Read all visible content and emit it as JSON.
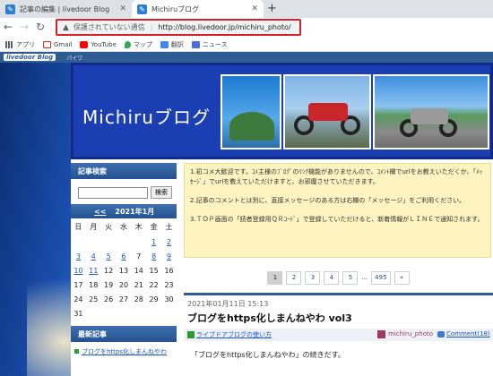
{
  "browser": {
    "tabs": [
      {
        "title": "記事の編集 | livedoor Blog",
        "favicon": "livedoor-favicon",
        "active": false
      },
      {
        "title": "Michiruブログ",
        "favicon": "livedoor-favicon",
        "active": true
      }
    ],
    "new_tab_label": "+",
    "address_bar": {
      "security_text": "保護されていない通信",
      "separator": "|",
      "url": "http://blog.livedoor.jp/michiru_photo/"
    },
    "bookmarks": [
      {
        "label": "アプリ",
        "icon": "apps-grid-icon",
        "color": "#5f6368"
      },
      {
        "label": "Gmail",
        "icon": "gmail-icon",
        "color": "#d93025"
      },
      {
        "label": "YouTube",
        "icon": "youtube-icon",
        "color": "#ff0000"
      },
      {
        "label": "マップ",
        "icon": "maps-pin-icon",
        "color": "#34a853"
      },
      {
        "label": "翻訳",
        "icon": "translate-icon",
        "color": "#4285f4"
      },
      {
        "label": "ニュース",
        "icon": "news-icon",
        "color": "#4a6fd8"
      }
    ]
  },
  "livedoor_bar": {
    "logo": "livedoor",
    "logo_suffix": "Blog",
    "link": "パイワ"
  },
  "header": {
    "title": "Michiruブログ"
  },
  "sidebar": {
    "search": {
      "heading": "記事検索",
      "button": "検索",
      "placeholder": ""
    },
    "calendar": {
      "prev": "<<",
      "month": "2021年1月",
      "weekdays": [
        "日",
        "月",
        "火",
        "水",
        "木",
        "金",
        "土"
      ],
      "weeks": [
        [
          "",
          "",
          "",
          "",
          "",
          "1",
          "2"
        ],
        [
          "3",
          "4",
          "5",
          "6",
          "7",
          "8",
          "9"
        ],
        [
          "10",
          "11",
          "12",
          "13",
          "14",
          "15",
          "16"
        ],
        [
          "17",
          "18",
          "19",
          "20",
          "21",
          "22",
          "23"
        ],
        [
          "24",
          "25",
          "26",
          "27",
          "28",
          "29",
          "30"
        ],
        [
          "31",
          "",
          "",
          "",
          "",
          "",
          ""
        ]
      ],
      "linked_days": [
        "1",
        "2",
        "3",
        "4",
        "5",
        "6",
        "8",
        "9",
        "10",
        "11"
      ]
    },
    "recent": {
      "heading": "最新記事",
      "items": [
        "ブログをhttps化しまんねやわ"
      ]
    }
  },
  "notice": {
    "paragraphs": [
      "1.初コメ大歓迎です。ｺﾒ主様のﾌﾞﾛｸﾞのﾘﾝｸ機能がありませんので、ｺﾒﾝﾄ欄でurlをお教えいただくか、「ﾒｯｾｰｼﾞ」でurlを教えていただけますと、お邪魔させていただきます。",
      "2.記事のコメントとは別に、直接メッセージのある方は右欄の「メッセージ」をご利用ください。",
      "3.ＴＯＰ画面の「読者登録用ＱＲｺｰﾄﾞ」で登録していただけると、新着情報がＬＩＮＥで通知されます。"
    ]
  },
  "pagination": {
    "pages": [
      "1",
      "2",
      "3",
      "4",
      "5"
    ],
    "current": "1",
    "ellipsis": "...",
    "last": "495",
    "next": "»"
  },
  "post": {
    "date": "2021年01月11日 15:13",
    "title": "ブログをhttps化しまんねやわ vol3",
    "category": "ライブドアブログの使い方",
    "author": "michiru_photo",
    "comments": "Comment(18)",
    "body_start": "「ブログをhttps化しまんねやわ」の続きだす。"
  }
}
